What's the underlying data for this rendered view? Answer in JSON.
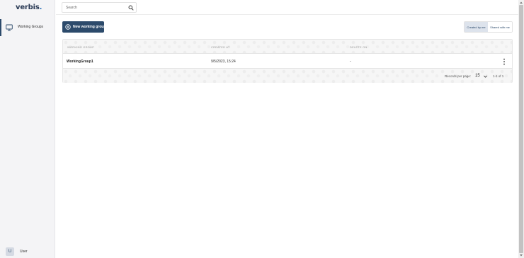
{
  "app": {
    "logo_main": "verbis",
    "logo_dot": "."
  },
  "sidebar": {
    "items": [
      {
        "label": "Working Groups",
        "icon": "monitor-icon",
        "active": true
      }
    ],
    "user": {
      "avatar_letter": "U",
      "name": "User"
    }
  },
  "header": {
    "search": {
      "placeholder": "Search",
      "value": "",
      "icon": "search-icon"
    }
  },
  "toolbar": {
    "new_button_label": "New working group",
    "new_button_icon": "plus-circle-icon",
    "filter_tabs": [
      {
        "label": "Created by me",
        "selected": true
      },
      {
        "label": "Shared with me",
        "selected": false
      }
    ]
  },
  "table": {
    "columns": [
      "WORKING GROUP",
      "CREATED AT",
      "DELETE ON"
    ],
    "rows": [
      {
        "name": "WorkingGroup1",
        "created_at": "9/5/2023, 15:24",
        "delete_on": "-"
      }
    ],
    "footer": {
      "records_per_page_label": "Records per page:",
      "records_per_page": "15",
      "range": "1-1 of 1"
    }
  },
  "colors": {
    "primary": "#2c4a6b",
    "sidebar_bg": "#f4f4f6",
    "toggle_active_bg": "#dde3ec"
  }
}
